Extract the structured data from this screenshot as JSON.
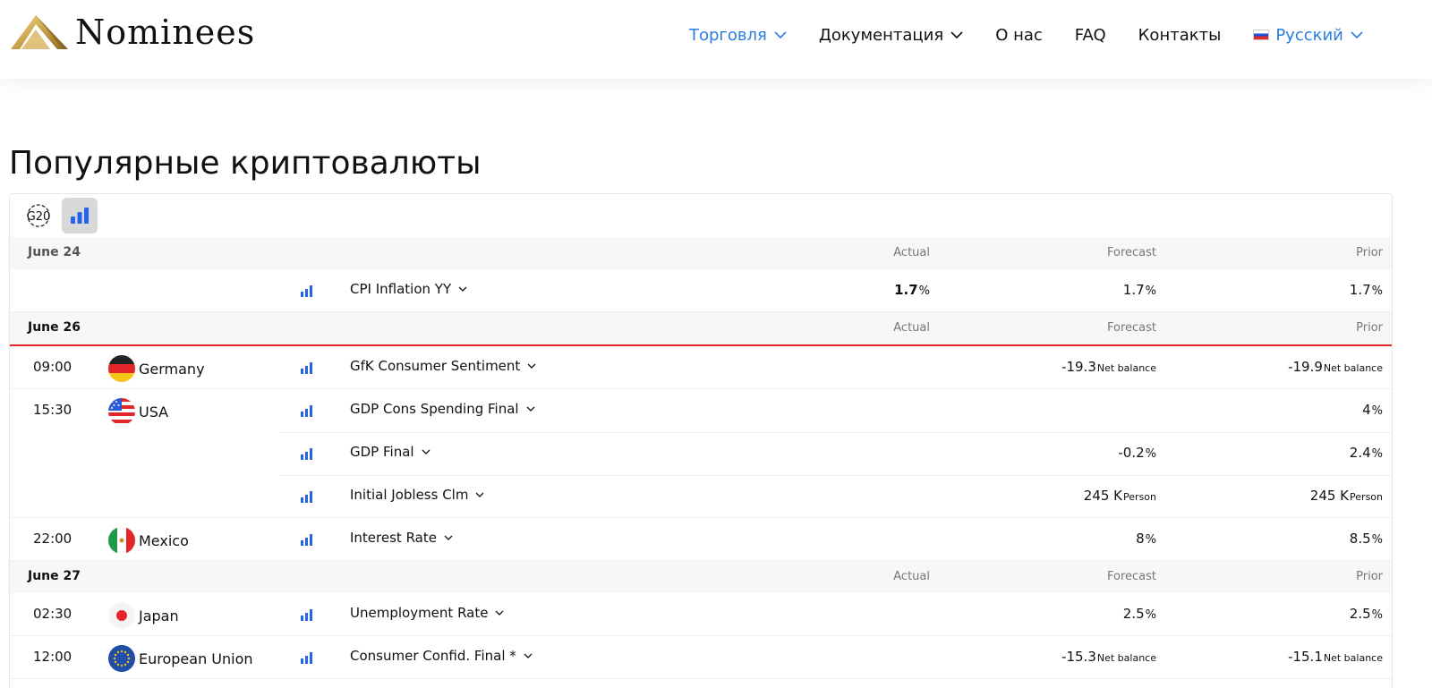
{
  "brand": {
    "name": "Nominees"
  },
  "nav": {
    "items": [
      {
        "label": "Торговля",
        "dropdown": true,
        "active": true
      },
      {
        "label": "Документация",
        "dropdown": true,
        "active": false
      },
      {
        "label": "О нас",
        "dropdown": false,
        "active": false
      },
      {
        "label": "FAQ",
        "dropdown": false,
        "active": false
      },
      {
        "label": "Контакты",
        "dropdown": false,
        "active": false
      }
    ],
    "language": {
      "label": "Русский",
      "flag": "russia-flag-icon"
    }
  },
  "page": {
    "title": "Популярные криптовалюты"
  },
  "toolbar": {
    "filters": [
      "g20-icon",
      "bar-chart-icon"
    ]
  },
  "colors": {
    "accent": "#2a7de1",
    "importance": "#2563eb",
    "divider_red": "#e3262a"
  },
  "calendar": {
    "columns": {
      "actual": "Actual",
      "forecast": "Forecast",
      "prior": "Prior"
    },
    "groups": [
      {
        "date": "June 24",
        "events": [
          {
            "time": "",
            "country": "",
            "flag": "",
            "name": "CPI Inflation YY",
            "actual": "1.7",
            "actual_unit": "%",
            "forecast": "1.7",
            "forecast_unit": "%",
            "prior": "1.7",
            "prior_unit": "%"
          }
        ]
      },
      {
        "date": "June 26",
        "events": [
          {
            "time": "09:00",
            "country": "Germany",
            "flag": "germany-flag-icon",
            "name": "GfK Consumer Sentiment",
            "actual": "",
            "actual_unit": "",
            "forecast": "-19.3",
            "forecast_unit": "Net balance",
            "prior": "-19.9",
            "prior_unit": "Net balance"
          },
          {
            "time": "15:30",
            "country": "USA",
            "flag": "usa-flag-icon",
            "name": "GDP Cons Spending Final",
            "actual": "",
            "actual_unit": "",
            "forecast": "",
            "forecast_unit": "",
            "prior": "4",
            "prior_unit": "%"
          },
          {
            "time": "",
            "country": "",
            "flag": "",
            "name": "GDP Final",
            "actual": "",
            "actual_unit": "",
            "forecast": "-0.2",
            "forecast_unit": "%",
            "prior": "2.4",
            "prior_unit": "%"
          },
          {
            "time": "",
            "country": "",
            "flag": "",
            "name": "Initial Jobless Clm",
            "actual": "",
            "actual_unit": "",
            "forecast": "245 K",
            "forecast_unit": "Person",
            "prior": "245 K",
            "prior_unit": "Person"
          },
          {
            "time": "22:00",
            "country": "Mexico",
            "flag": "mexico-flag-icon",
            "name": "Interest Rate",
            "actual": "",
            "actual_unit": "",
            "forecast": "8",
            "forecast_unit": "%",
            "prior": "8.5",
            "prior_unit": "%"
          }
        ]
      },
      {
        "date": "June 27",
        "events": [
          {
            "time": "02:30",
            "country": "Japan",
            "flag": "japan-flag-icon",
            "name": "Unemployment Rate",
            "actual": "",
            "actual_unit": "",
            "forecast": "2.5",
            "forecast_unit": "%",
            "prior": "2.5",
            "prior_unit": "%"
          },
          {
            "time": "12:00",
            "country": "European Union",
            "flag": "eu-flag-icon",
            "name": "Consumer Confid. Final *",
            "actual": "",
            "actual_unit": "",
            "forecast": "-15.3",
            "forecast_unit": "Net balance",
            "prior": "-15.1",
            "prior_unit": "Net balance"
          }
        ]
      }
    ]
  }
}
